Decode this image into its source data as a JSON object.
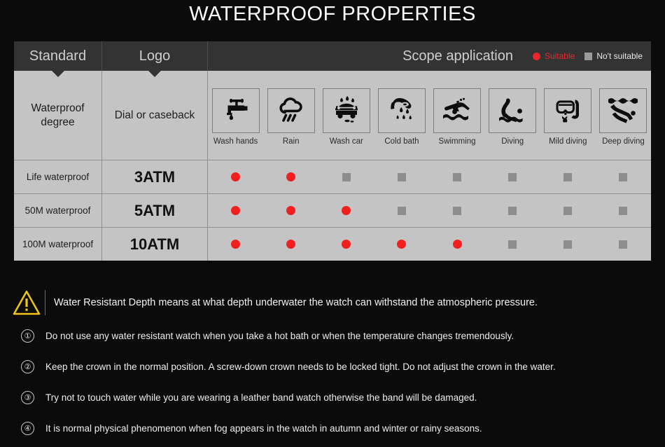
{
  "title": "WATERPROOF PROPERTIES",
  "table": {
    "header": {
      "standard": "Standard",
      "logo": "Logo",
      "scope": "Scope application",
      "legend_suitable": "Suitable",
      "legend_not_suitable": "No't  suitable"
    },
    "subheader": {
      "standard": "Waterproof degree",
      "standard_line1": "Waterproof",
      "standard_line2": "degree",
      "logo": "Dial or caseback"
    },
    "activities": [
      {
        "icon": "faucet-icon",
        "label": "Wash hands"
      },
      {
        "icon": "rain-cloud-icon",
        "label": "Rain"
      },
      {
        "icon": "car-wash-icon",
        "label": "Wash car"
      },
      {
        "icon": "shower-icon",
        "label": "Cold bath"
      },
      {
        "icon": "swimmer-icon",
        "label": "Swimming"
      },
      {
        "icon": "diver-icon",
        "label": "Diving"
      },
      {
        "icon": "snorkel-mask-icon",
        "label": "Mild diving"
      },
      {
        "icon": "deep-diver-icon",
        "label": "Deep diving"
      }
    ],
    "rows": [
      {
        "standard": "Life waterproof",
        "logo": "3ATM",
        "marks": [
          "suitable",
          "suitable",
          "not",
          "not",
          "not",
          "not",
          "not",
          "not"
        ]
      },
      {
        "standard": "50M waterproof",
        "logo": "5ATM",
        "marks": [
          "suitable",
          "suitable",
          "suitable",
          "not",
          "not",
          "not",
          "not",
          "not"
        ]
      },
      {
        "standard": "100M waterproof",
        "logo": "10ATM",
        "marks": [
          "suitable",
          "suitable",
          "suitable",
          "suitable",
          "suitable",
          "not",
          "not",
          "not"
        ]
      }
    ]
  },
  "notice": {
    "icon": "warning-triangle-icon",
    "text": "Water Resistant Depth means at what depth underwater the watch can withstand the atmospheric pressure."
  },
  "notes": [
    {
      "num": "①",
      "text": "Do not use any water resistant watch when you take a hot bath or when the temperature changes tremendously."
    },
    {
      "num": "②",
      "text": "Keep the crown in the normal position. A screw-down crown needs to be locked tight. Do not adjust the crown in the water."
    },
    {
      "num": "③",
      "text": "Try not to touch water while you are wearing a leather band watch otherwise the band will be damaged."
    },
    {
      "num": "④",
      "text": "It is normal physical phenomenon when fog appears in the watch in autumn and winter or rainy seasons."
    }
  ],
  "colors": {
    "suitable": "#f02020",
    "not_suitable": "#8d8d8d",
    "header_band": "#333333",
    "table_body": "#c4c4c4",
    "background": "#0b0b0b",
    "warning": "#f0c419"
  }
}
